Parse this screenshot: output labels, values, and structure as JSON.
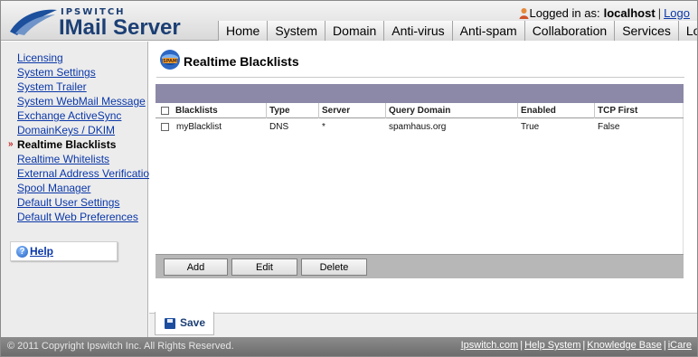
{
  "brand": {
    "small": "IPSWITCH",
    "name": "IMail Server"
  },
  "login": {
    "prefix": "Logged in as:",
    "user": "localhost",
    "logout": "Logo"
  },
  "nav": [
    "Home",
    "System",
    "Domain",
    "Anti-virus",
    "Anti-spam",
    "Collaboration",
    "Services",
    "Loggin"
  ],
  "sidebar": {
    "items": [
      {
        "label": "Licensing",
        "active": false
      },
      {
        "label": "System Settings",
        "active": false
      },
      {
        "label": "System Trailer",
        "active": false
      },
      {
        "label": "System WebMail Message",
        "active": false
      },
      {
        "label": "Exchange ActiveSync",
        "active": false
      },
      {
        "label": "DomainKeys / DKIM",
        "active": false
      },
      {
        "label": "Realtime Blacklists",
        "active": true
      },
      {
        "label": "Realtime Whitelists",
        "active": false
      },
      {
        "label": "External Address Verification",
        "active": false
      },
      {
        "label": "Spool Manager",
        "active": false
      },
      {
        "label": "Default User Settings",
        "active": false
      },
      {
        "label": "Default Web Preferences",
        "active": false
      }
    ],
    "help": "Help"
  },
  "page": {
    "title": "Realtime Blacklists",
    "icon": "spam-icon"
  },
  "table": {
    "columns": [
      "Blacklists",
      "Type",
      "Server",
      "Query Domain",
      "Enabled",
      "TCP First"
    ],
    "rows": [
      {
        "checked": false,
        "cells": [
          "myBlacklist",
          "DNS",
          "*",
          "spamhaus.org",
          "True",
          "False"
        ]
      }
    ]
  },
  "buttons": {
    "add": "Add",
    "edit": "Edit",
    "delete": "Delete",
    "save": "Save"
  },
  "footer": {
    "copyright": "© 2011 Copyright Ipswitch Inc. All Rights Reserved.",
    "links": [
      "Ipswitch.com",
      "Help System",
      "Knowledge Base",
      "iCare"
    ]
  },
  "colors": {
    "brand": "#1c3f74",
    "link": "#0a37a8",
    "table_band": "#8b88a8",
    "footer": "#7a7a7a"
  }
}
